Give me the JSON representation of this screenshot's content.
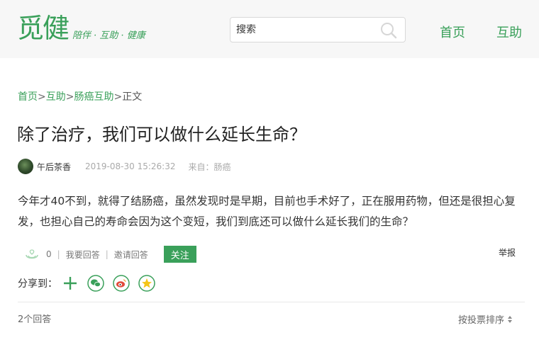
{
  "header": {
    "logo_text": "觅健",
    "slogan": "陪伴 · 互助 · 健康",
    "search_placeholder": "搜索",
    "nav": [
      {
        "label": "首页"
      },
      {
        "label": "互助"
      }
    ]
  },
  "breadcrumb": {
    "items": [
      {
        "label": "首页"
      },
      {
        "label": "互助"
      },
      {
        "label": "肠癌互助"
      }
    ],
    "current": "正文",
    "separator": ">"
  },
  "article": {
    "title": "除了治疗，我们可以做什么延长生命？",
    "author": "午后茶香",
    "date": "2019-08-30 15:26:32",
    "source": "来自：肠癌",
    "body": "今年才40不到，就得了结肠癌，虽然发现时是早期，目前也手术好了，正在服用药物，但还是很担心复发，也担心自己的寿命会因为这个变短，我们到底还可以做什么延长我们的生命？"
  },
  "actions": {
    "like_count": "0",
    "answer_label": "我要回答",
    "invite_label": "邀请回答",
    "follow_label": "关注",
    "report_label": "举报",
    "divider": "|"
  },
  "share": {
    "label": "分享到：",
    "icons": [
      "plus-icon",
      "wechat-icon",
      "weibo-icon",
      "qzone-icon"
    ]
  },
  "answers": {
    "count_label": "2个回答",
    "sort_label": "按投票排序"
  },
  "colors": {
    "brand_green": "#3aa05a",
    "header_bg": "#f7f7f7",
    "muted_text": "#aaaaaa"
  }
}
